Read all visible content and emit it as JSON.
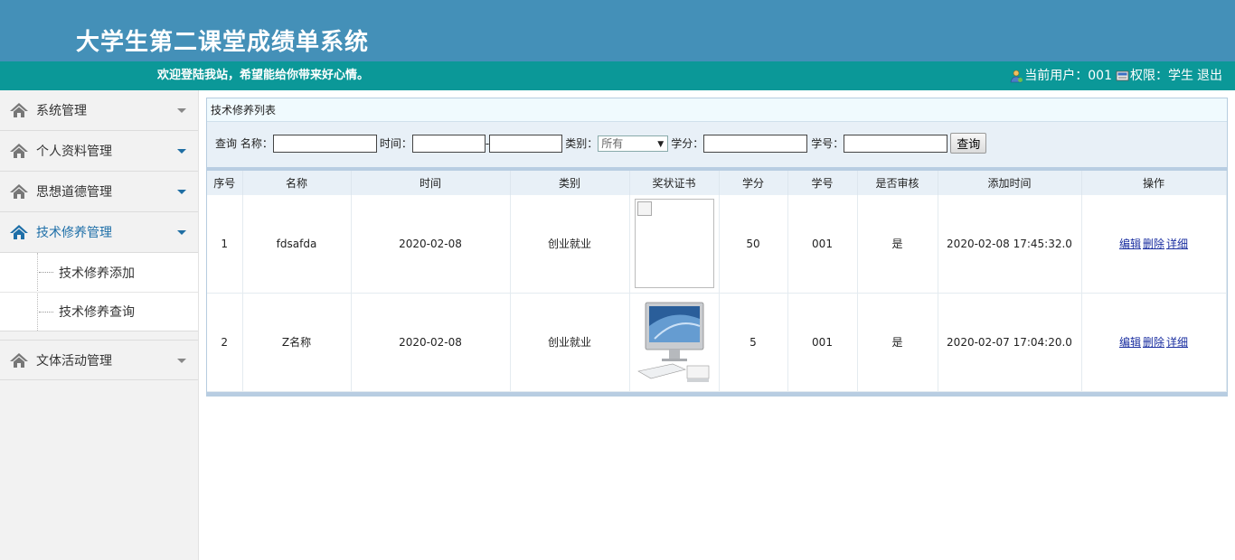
{
  "header": {
    "title": "大学生第二课堂成绩单系统",
    "welcome": "欢迎登陆我站，希望能给你带来好心情。",
    "user_label": "当前用户：",
    "user_value": "001",
    "role_label": "权限：",
    "role_value": "学生",
    "logout": "退出"
  },
  "sidebar": {
    "items": [
      {
        "label": "系统管理"
      },
      {
        "label": "个人资料管理"
      },
      {
        "label": "思想道德管理"
      },
      {
        "label": "技术修养管理"
      },
      {
        "label": "文体活动管理"
      }
    ],
    "submenu": [
      {
        "label": "技术修养添加"
      },
      {
        "label": "技术修养查询"
      }
    ]
  },
  "panel": {
    "title": "技术修养列表"
  },
  "search": {
    "prefix": "查询 名称：",
    "time_label": "时间：",
    "range_sep": "-",
    "category_label": "类别：",
    "category_value": "所有",
    "credit_label": "学分：",
    "student_label": "学号：",
    "query_button": "查询",
    "name_value": "",
    "time_from": "",
    "time_to": "",
    "credit_value": "",
    "student_value": ""
  },
  "table": {
    "columns": [
      "序号",
      "名称",
      "时间",
      "类别",
      "奖状证书",
      "学分",
      "学号",
      "是否审核",
      "添加时间",
      "操作"
    ],
    "rows": [
      {
        "no": "1",
        "name": "fdsafda",
        "time": "2020-02-08",
        "category": "创业就业",
        "cert": "broken-image",
        "credit": "50",
        "student": "001",
        "reviewed": "是",
        "added": "2020-02-08 17:45:32.0"
      },
      {
        "no": "2",
        "name": "Z名称",
        "time": "2020-02-08",
        "category": "创业就业",
        "cert": "computer-image",
        "credit": "5",
        "student": "001",
        "reviewed": "是",
        "added": "2020-02-07 17:04:20.0"
      }
    ],
    "actions": {
      "edit": "编辑",
      "delete": "删除",
      "detail": "详细"
    }
  },
  "colors": {
    "banner": "#4490b8",
    "welcome_bar": "#0b9898",
    "active_menu": "#1e6fa8"
  }
}
